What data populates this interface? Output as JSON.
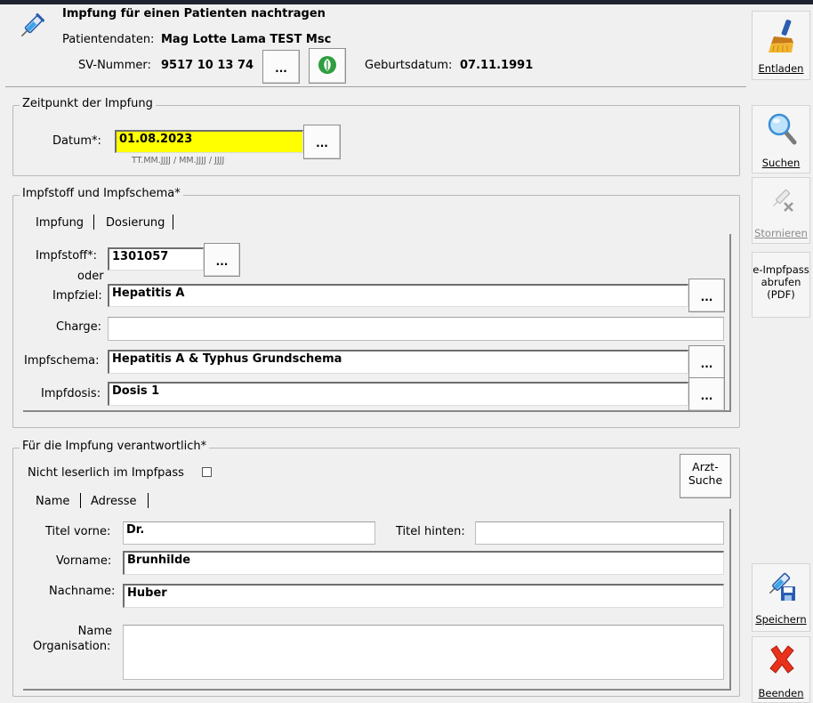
{
  "header": {
    "title": "Impfung für einen Patienten nachtragen",
    "patient_label": "Patientendaten:",
    "patient_name": "Mag Lotte Lama TEST Msc",
    "sv_label": "SV-Nummer:",
    "sv_value": "9517 10 13 74",
    "sv_button": "...",
    "birth_label": "Geburtsdatum:",
    "birth_value": "07.11.1991"
  },
  "timing": {
    "title": "Zeitpunkt der Impfung",
    "date_label": "Datum*:",
    "date_value": "01.08.2023",
    "date_button": "...",
    "date_hint": "TT.MM.JJJJ / MM.JJJJ / JJJJ"
  },
  "vaccine": {
    "title": "Impfstoff und Impfschema*",
    "tabs": [
      "Impfung",
      "Dosierung"
    ],
    "impfstoff_label": "Impfstoff*:",
    "impfstoff_value": "1301057",
    "oder_label": "oder",
    "impfziel_label": "Impfziel:",
    "impfziel_value": "Hepatitis A",
    "charge_label": "Charge:",
    "charge_value": "",
    "impfschema_label": "Impfschema:",
    "impfschema_value": "Hepatitis A & Typhus Grundschema",
    "impfdosis_label": "Impfdosis:",
    "impfdosis_value": "Dosis 1",
    "dots": "..."
  },
  "responsible": {
    "title": "Für die Impfung verantwortlich*",
    "unreadable_label": "Nicht leserlich im Impfpass",
    "arzt_button_line1": "Arzt-",
    "arzt_button_line2": "Suche",
    "tabs": [
      "Name",
      "Adresse"
    ],
    "titel_vorne_label": "Titel vorne:",
    "titel_vorne_value": "Dr.",
    "titel_hinten_label": "Titel hinten:",
    "titel_hinten_value": "",
    "vorname_label": "Vorname:",
    "vorname_value": "Brunhilde",
    "nachname_label": "Nachname:",
    "nachname_value": "Huber",
    "org_label_line1": "Name",
    "org_label_line2": "Organisation:",
    "org_value": ""
  },
  "sidebar": {
    "entladen": "Entladen",
    "suchen": "Suchen",
    "stornieren": "Stornieren",
    "eimpfpass_line1": "e-Impfpass",
    "eimpfpass_line2": "abrufen",
    "eimpfpass_line3": "(PDF)",
    "speichern": "Speichern",
    "beenden": "Beenden"
  },
  "colors": {
    "date_highlight": "#ffff00",
    "cancel_red": "#e8321c",
    "leaf_green": "#2e9e3f"
  },
  "icons": [
    "syringe-icon",
    "leaf-icon",
    "broom-icon",
    "magnifier-icon",
    "syringe-cancel-icon",
    "syringe-save-icon",
    "red-x-icon"
  ]
}
